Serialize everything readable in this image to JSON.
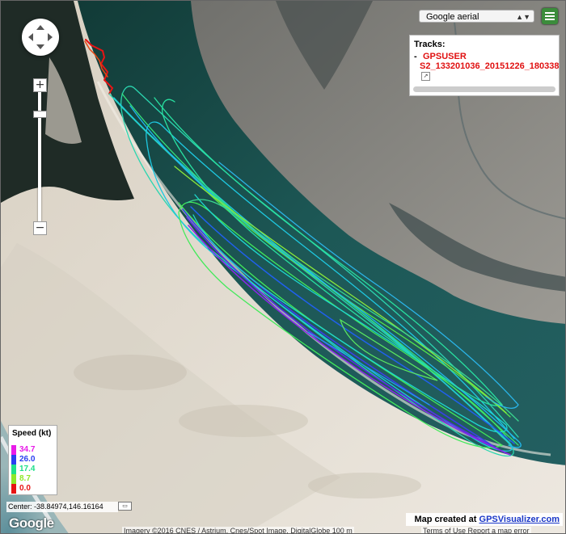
{
  "map_type": {
    "selected": "Google aerial"
  },
  "tracks_panel": {
    "title": "Tracks:",
    "bullet": "-",
    "track_line1": "GPSUSER",
    "track_line2": "S2_133201036_20151226_180338_"
  },
  "legend": {
    "title": "Speed (kt)",
    "entries": [
      {
        "label": "34.7",
        "color": "#e81ce8"
      },
      {
        "label": "26.0",
        "color": "#2a3ef0"
      },
      {
        "label": "17.4",
        "color": "#1ee08a"
      },
      {
        "label": "8.7",
        "color": "#8ee82a"
      },
      {
        "label": "0.0",
        "color": "#e81414"
      }
    ]
  },
  "center_readout": "Center: -38.84974,146.16164",
  "logo": "Google",
  "attribution": "Imagery ©2016 CNES / Astrium, Cnes/Spot Image, DigitalGlobe    100 m",
  "attribution_right": "Terms of Use    Report a map error",
  "credit": {
    "prefix": "Map created at ",
    "link": "GPSVisualizer.com"
  },
  "zoom": {
    "plus": "+",
    "minus": "−"
  },
  "colors": {
    "water": "#1a4a4a",
    "sand": "#e8e2d8",
    "flats": "#8a8a86",
    "forest": "#1e2a24"
  }
}
